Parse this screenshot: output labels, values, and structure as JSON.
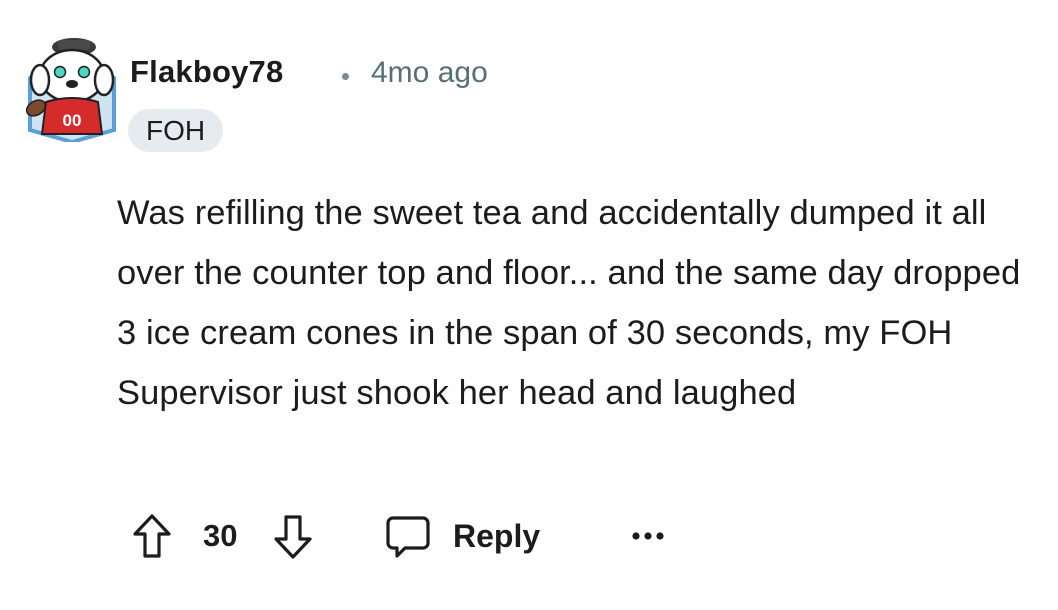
{
  "comment": {
    "author": "Flakboy78",
    "separator": "•",
    "timestamp": "4mo ago",
    "flair": "FOH",
    "body": "Was refilling the sweet tea and accidentally dumped it all over the counter top and floor... and the same day dropped 3 ice cream cones in the span of 30 seconds, my FOH Supervisor just shook her head and laughed",
    "avatar": {
      "icon": "dog-football-avatar",
      "jersey_number": "00",
      "colors": {
        "jersey": "#d62b2b",
        "badge": "#5a9fd6",
        "eyes": "#4fd6c0"
      }
    }
  },
  "actions": {
    "upvote_icon": "arrow-up-icon",
    "score": "30",
    "downvote_icon": "arrow-down-icon",
    "reply_icon": "speech-bubble-icon",
    "reply_label": "Reply",
    "more_icon": "ellipsis-icon"
  },
  "colors": {
    "text": "#1c1c1c",
    "muted": "#576f76",
    "flair_bg": "#e5ebee"
  }
}
